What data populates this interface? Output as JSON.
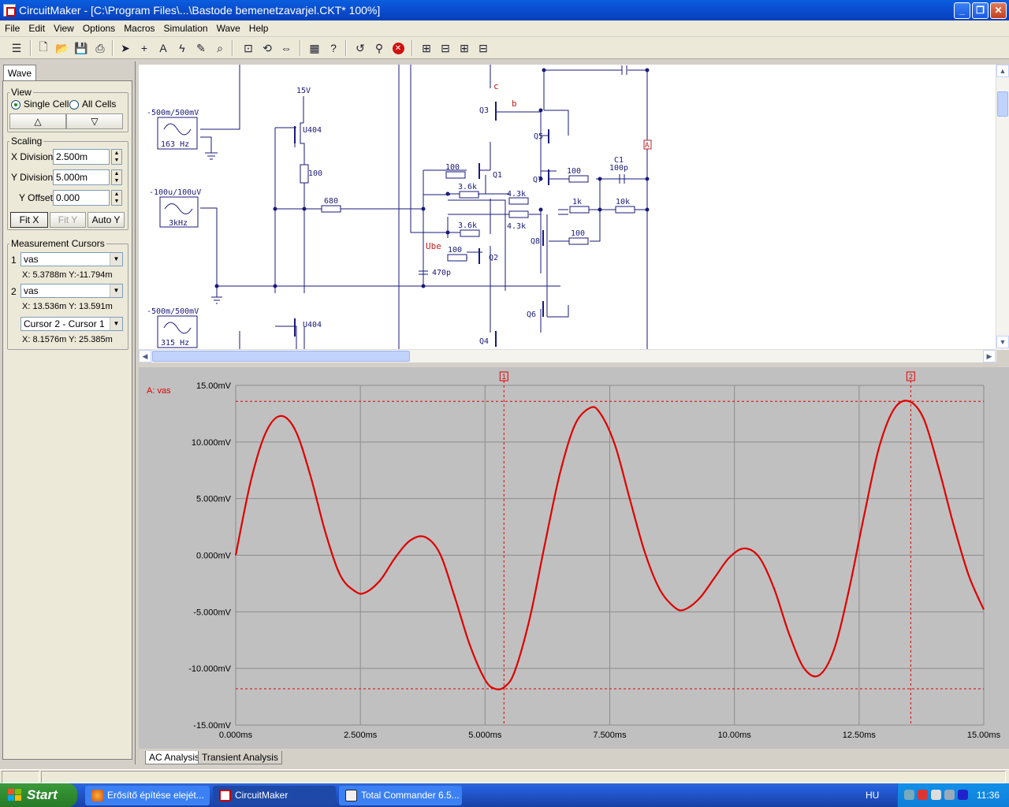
{
  "window": {
    "title": "CircuitMaker - [C:\\Program Files\\...\\Bastode bemenetzavarjel.CKT* 100%]",
    "controls": {
      "minimize": "_",
      "restore": "❐",
      "close": "✕"
    }
  },
  "menu": [
    "File",
    "Edit",
    "View",
    "Options",
    "Macros",
    "Simulation",
    "Wave",
    "Help"
  ],
  "toolbar": {
    "icons": [
      "panel-toggle-icon",
      "new-file-icon",
      "open-folder-icon",
      "save-icon",
      "print-icon",
      "arrow-pointer-icon",
      "wire-cross-icon",
      "text-tool-icon",
      "lightning-icon",
      "probe-icon",
      "zoom-icon",
      "zoom-fit-icon",
      "rotate-icon",
      "mirror-icon",
      "netlist-icon",
      "help-icon",
      "reset-icon",
      "tweak-icon",
      "stop-icon",
      "analysis1-icon",
      "analysis2-icon",
      "analysis3-icon",
      "analysis4-icon"
    ]
  },
  "panel": {
    "tab": "Wave",
    "view": {
      "title": "View",
      "single_cell": "Single Cell",
      "all_cells": "All Cells",
      "selected": "single_cell",
      "up": "△",
      "down": "▽"
    },
    "scaling": {
      "title": "Scaling",
      "x_label": "X Division",
      "x_value": "2.500m",
      "y_label": "Y Division",
      "y_value": "5.000m",
      "offset_label": "Y Offset",
      "offset_value": "0.000",
      "fit_x": "Fit X",
      "fit_y": "Fit Y",
      "auto_y": "Auto Y"
    },
    "cursors": {
      "title": "Measurement Cursors",
      "c1_num": "1",
      "c1_select": "vas",
      "c1_readout": "X: 5.3788m  Y:-11.794m",
      "c2_num": "2",
      "c2_select": "vas",
      "c2_readout": "X: 13.536m  Y: 13.591m",
      "diff_select": "Cursor 2 - Cursor 1",
      "diff_readout": "X: 8.1576m  Y: 25.385m"
    }
  },
  "schematic": {
    "labels": {
      "src1": "-500m/500mV",
      "src1_freq": "163 Hz",
      "src2": "-100u/100uV",
      "src2_freq": "3kHz",
      "src3": "-500m/500mV",
      "src3_freq": "315 Hz",
      "v15": "15V",
      "u404a": "U404",
      "u404b": "U404",
      "r100a": "100",
      "r680": "680",
      "q1": "Q1",
      "q2": "Q2",
      "q3": "Q3",
      "q4": "Q4",
      "q5": "Q5",
      "q6": "Q6",
      "q7": "Q7",
      "q8": "Q8",
      "c": "c",
      "b": "b",
      "ube": "Ube",
      "r100b": "100",
      "r36a": "3.6k",
      "r43a": "4.3k",
      "r36b": "3.6k",
      "r43b": "4.3k",
      "r100c": "100",
      "c470": "470p",
      "r100d": "100",
      "c1": "C1",
      "c1v": "100p",
      "r1k": "1k",
      "r10k": "10k",
      "r100e": "100",
      "probe": "A"
    }
  },
  "graph": {
    "trace_label": "A: vas",
    "cursor1_label": "1",
    "cursor2_label": "2",
    "tabs": [
      "AC Analysis",
      "Transient Analysis"
    ],
    "colors": {
      "trace": "#e00000",
      "bg": "#c0c0c0",
      "grid": "#8c8c8c"
    }
  },
  "chart_data": {
    "type": "line",
    "title": "",
    "xlabel": "",
    "ylabel": "",
    "xlim": [
      0,
      15
    ],
    "ylim": [
      -15,
      15
    ],
    "x_ticks": [
      "0.000ms",
      "2.500ms",
      "5.000ms",
      "7.500ms",
      "10.00ms",
      "12.50ms",
      "15.00ms"
    ],
    "y_ticks": [
      "15.00mV",
      "10.000mV",
      "5.000mV",
      "0.000mV",
      "-5.000mV",
      "-10.000mV",
      "-15.00mV"
    ],
    "series": [
      {
        "name": "A: vas",
        "x": [
          0,
          0.3,
          0.6,
          0.9,
          1.2,
          1.5,
          1.8,
          2.1,
          2.4,
          2.6,
          2.9,
          3.2,
          3.5,
          3.8,
          4.1,
          4.4,
          4.7,
          5.0,
          5.2,
          5.4,
          5.6,
          5.9,
          6.2,
          6.5,
          6.8,
          7.1,
          7.3,
          7.6,
          7.9,
          8.2,
          8.5,
          8.8,
          9.0,
          9.3,
          9.6,
          9.9,
          10.2,
          10.5,
          10.8,
          11.1,
          11.4,
          11.7,
          12.0,
          12.3,
          12.6,
          12.9,
          13.2,
          13.5,
          13.8,
          14.1,
          14.4,
          14.7,
          15.0
        ],
        "y": [
          0,
          6.5,
          10.8,
          12.3,
          11.0,
          7.0,
          2.0,
          -1.8,
          -3.2,
          -3.3,
          -2.2,
          -0.2,
          1.3,
          1.6,
          0.1,
          -3.8,
          -8.0,
          -11.0,
          -11.8,
          -11.6,
          -10.2,
          -5.5,
          1.0,
          7.2,
          11.5,
          13.0,
          12.6,
          9.8,
          5.0,
          0.3,
          -3.0,
          -4.6,
          -4.8,
          -3.8,
          -2.0,
          -0.2,
          0.6,
          -0.2,
          -3.0,
          -7.0,
          -10.0,
          -10.6,
          -8.3,
          -3.0,
          3.5,
          9.5,
          12.9,
          13.6,
          12.0,
          7.6,
          2.6,
          -1.8,
          -4.8
        ]
      }
    ],
    "cursors": [
      {
        "label": "1",
        "x": 5.3788,
        "y": -11.794
      },
      {
        "label": "2",
        "x": 13.536,
        "y": 13.591
      }
    ],
    "grid": true
  },
  "statusbar": {
    "text": ""
  },
  "taskbar": {
    "start": "Start",
    "tasks": [
      {
        "label": "Erősítő építése elejét...",
        "active": false
      },
      {
        "label": "CircuitMaker",
        "active": true
      },
      {
        "label": "Total Commander 6.5...",
        "active": false
      }
    ],
    "lang": "HU",
    "clock": "11:36"
  }
}
